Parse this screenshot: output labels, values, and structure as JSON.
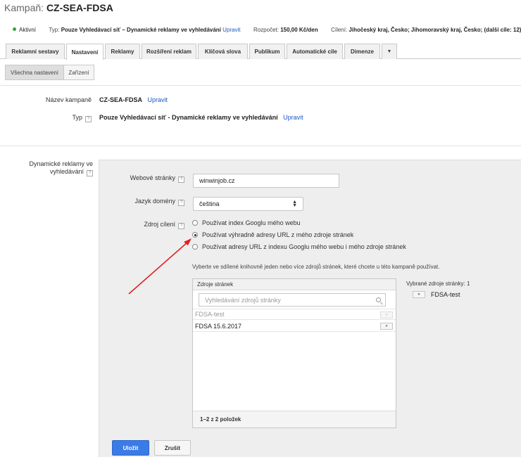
{
  "header": {
    "campaign_label": "Kampaň:",
    "campaign_name": "CZ-SEA-FDSA"
  },
  "info_bar": {
    "status": "Aktivní",
    "type_label": "Typ:",
    "type_value": "Pouze Vyhledávací síť – Dynamické reklamy ve vyhledávání",
    "type_edit": "Upravit",
    "budget_label": "Rozpočet:",
    "budget_value": "150,00 Kč/den",
    "targeting_label": "Cílení:",
    "targeting_value": "Jihočeský kraj, Česko; Jihomoravský kraj, Česko; (další cíle: 12)"
  },
  "tabs": [
    {
      "label": "Reklamní sestavy"
    },
    {
      "label": "Nastavení"
    },
    {
      "label": "Reklamy"
    },
    {
      "label": "Rozšíření reklam"
    },
    {
      "label": "Klíčová slova"
    },
    {
      "label": "Publikum"
    },
    {
      "label": "Automatické cíle"
    },
    {
      "label": "Dimenze"
    }
  ],
  "subtabs": [
    {
      "label": "Všechna nastavení"
    },
    {
      "label": "Zařízení"
    }
  ],
  "campaign_name_field": {
    "label": "Název kampaně",
    "value": "CZ-SEA-FDSA",
    "edit": "Upravit"
  },
  "type_field": {
    "label": "Typ",
    "help": "?",
    "value": "Pouze Vyhledávací síť - Dynamické reklamy ve vyhledávání",
    "edit": "Upravit"
  },
  "dsa_section": {
    "label": "Dynamické reklamy ve vyhledávání",
    "help": "?"
  },
  "website_field": {
    "label": "Webové stránky",
    "help": "?",
    "value": "winwinjob.cz"
  },
  "language_field": {
    "label": "Jazyk domény",
    "help": "?",
    "value": "čeština"
  },
  "targeting_source": {
    "label": "Zdroj cílení",
    "help": "?",
    "options": [
      {
        "label": "Používat index Googlu mého webu",
        "checked": false
      },
      {
        "label": "Používat výhradně adresy URL z mého zdroje stránek",
        "checked": true
      },
      {
        "label": "Používat adresy URL z indexu Googlu mého webu i mého zdroje stránek",
        "checked": false
      }
    ]
  },
  "description": "Vyberte ve sdílené knihovně jeden nebo více zdrojů stránek, které chcete u této kampaně používat.",
  "sources": {
    "header": "Zdroje stránek",
    "search_placeholder": "Vyhledávání zdrojů stránky",
    "items": [
      {
        "name": "FDSA-test",
        "action": "»",
        "disabled": true
      },
      {
        "name": "FDSA 15.6.2017",
        "action": "»",
        "disabled": false
      }
    ],
    "footer": "1–2 z 2 položek"
  },
  "selected": {
    "title": "Vybrané zdroje stránky: 1",
    "items": [
      {
        "name": "FDSA-test",
        "action": "«"
      }
    ]
  },
  "buttons": {
    "save": "Uložit",
    "cancel": "Zrušit"
  },
  "colors": {
    "accent": "#3b7be8",
    "link": "#1a57c7",
    "status_active": "#3aa23a",
    "annotation_arrow": "#e02020"
  }
}
